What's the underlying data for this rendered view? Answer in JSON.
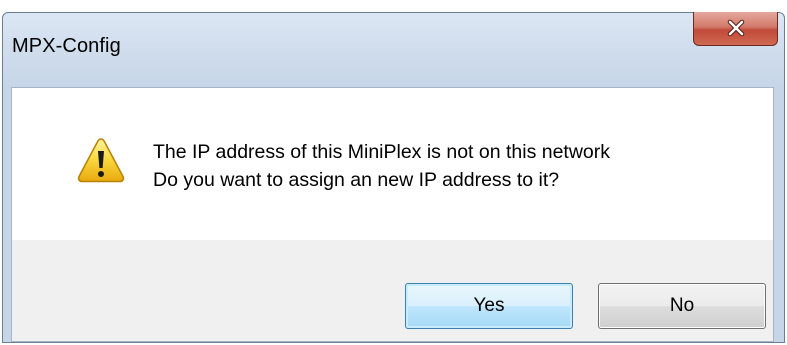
{
  "window": {
    "title": "MPX-Config"
  },
  "message": {
    "line1": "The IP address of this MiniPlex is not on this network",
    "line2": "Do you want to assign an new IP address to it?"
  },
  "buttons": {
    "yes_label": "Yes",
    "no_label": "No"
  },
  "icons": {
    "dialog_icon": "warning-icon",
    "close_icon": "close-icon"
  },
  "colors": {
    "close_button": "#c75a47",
    "warning_yellow": "#f7d22e",
    "default_button_border": "#3c7fb1"
  }
}
